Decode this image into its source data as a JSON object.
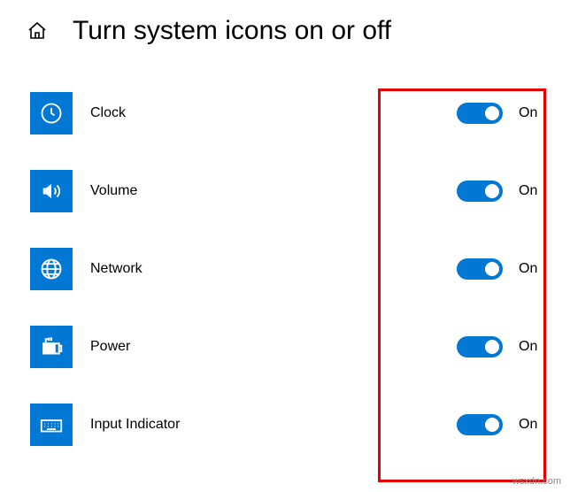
{
  "header": {
    "title": "Turn system icons on or off"
  },
  "items": [
    {
      "icon": "clock",
      "label": "Clock",
      "state": "On"
    },
    {
      "icon": "volume",
      "label": "Volume",
      "state": "On"
    },
    {
      "icon": "globe",
      "label": "Network",
      "state": "On"
    },
    {
      "icon": "power",
      "label": "Power",
      "state": "On"
    },
    {
      "icon": "keyboard",
      "label": "Input Indicator",
      "state": "On"
    }
  ],
  "watermark": "wsxdn.com"
}
